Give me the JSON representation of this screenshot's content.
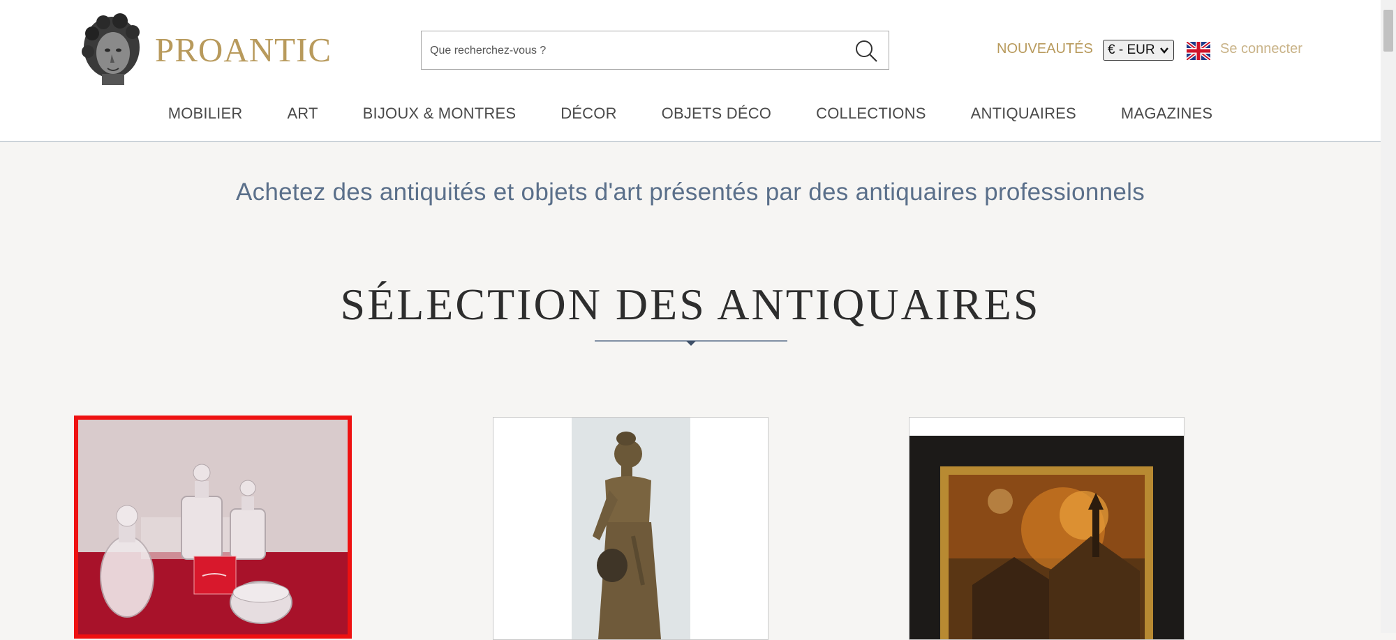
{
  "header": {
    "logo_text": "PROANTIC",
    "search": {
      "placeholder": "Que recherchez-vous ?",
      "value": ""
    },
    "nouveautes_label": "NOUVEAUTÉS",
    "currency": "€ - EUR",
    "language_flag_icon": "uk-flag-icon",
    "login_label": "Se connecter"
  },
  "nav": {
    "items": [
      {
        "label": "MOBILIER"
      },
      {
        "label": "ART"
      },
      {
        "label": "BIJOUX & MONTRES"
      },
      {
        "label": "DÉCOR"
      },
      {
        "label": "OBJETS DÉCO"
      },
      {
        "label": "COLLECTIONS"
      },
      {
        "label": "ANTIQUAIRES"
      },
      {
        "label": "MAGAZINES"
      }
    ]
  },
  "main": {
    "tagline": "Achetez des antiquités et objets d'art présentés par des antiquaires professionnels",
    "section_title": "SÉLECTION DES ANTIQUAIRES"
  },
  "colors": {
    "accent_gold": "#b89a5c",
    "tagline_blue": "#5a6f8a",
    "selection_red": "#ee1111",
    "background": "#f6f5f3"
  }
}
